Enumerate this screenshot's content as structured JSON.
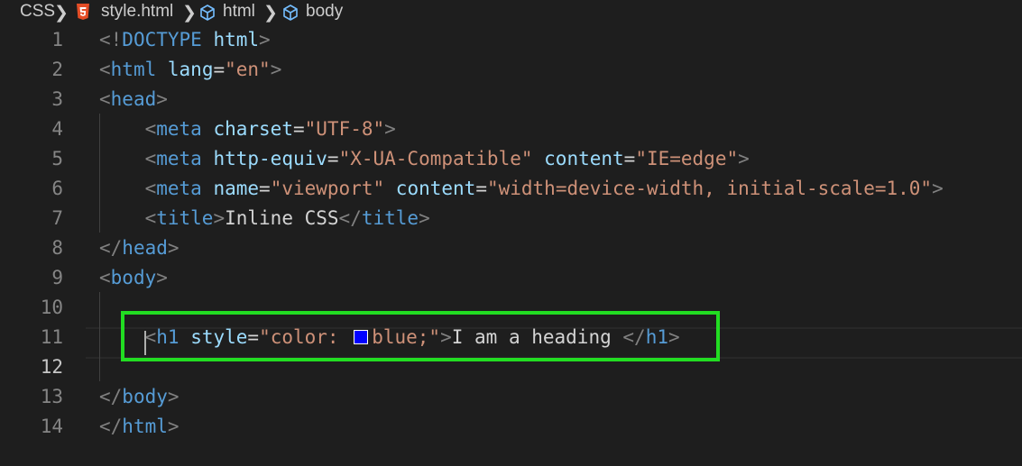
{
  "breadcrumb": {
    "items": [
      {
        "label": "CSS"
      },
      {
        "label": "style.html"
      },
      {
        "label": "html"
      },
      {
        "label": "body"
      }
    ]
  },
  "editor": {
    "current_line": 12,
    "line_numbers": [
      "1",
      "2",
      "3",
      "4",
      "5",
      "6",
      "7",
      "8",
      "9",
      "10",
      "11",
      "12",
      "13",
      "14"
    ],
    "swatch_color": "#0000ff",
    "highlight_color": "#22dd22",
    "lines": [
      [
        {
          "t": "<!",
          "c": "punct"
        },
        {
          "t": "DOCTYPE",
          "c": "tag"
        },
        {
          "t": " ",
          "c": "txt"
        },
        {
          "t": "html",
          "c": "attr"
        },
        {
          "t": ">",
          "c": "punct"
        }
      ],
      [
        {
          "t": "<",
          "c": "punct"
        },
        {
          "t": "html",
          "c": "tag"
        },
        {
          "t": " ",
          "c": "txt"
        },
        {
          "t": "lang",
          "c": "attr"
        },
        {
          "t": "=",
          "c": "txt"
        },
        {
          "t": "\"en\"",
          "c": "str"
        },
        {
          "t": ">",
          "c": "punct"
        }
      ],
      [
        {
          "t": "<",
          "c": "punct"
        },
        {
          "t": "head",
          "c": "tag"
        },
        {
          "t": ">",
          "c": "punct"
        }
      ],
      [
        {
          "t": "    ",
          "c": "txt"
        },
        {
          "t": "<",
          "c": "punct"
        },
        {
          "t": "meta",
          "c": "tag"
        },
        {
          "t": " ",
          "c": "txt"
        },
        {
          "t": "charset",
          "c": "attr"
        },
        {
          "t": "=",
          "c": "txt"
        },
        {
          "t": "\"UTF-8\"",
          "c": "str"
        },
        {
          "t": ">",
          "c": "punct"
        }
      ],
      [
        {
          "t": "    ",
          "c": "txt"
        },
        {
          "t": "<",
          "c": "punct"
        },
        {
          "t": "meta",
          "c": "tag"
        },
        {
          "t": " ",
          "c": "txt"
        },
        {
          "t": "http-equiv",
          "c": "attr"
        },
        {
          "t": "=",
          "c": "txt"
        },
        {
          "t": "\"X-UA-Compatible\"",
          "c": "str"
        },
        {
          "t": " ",
          "c": "txt"
        },
        {
          "t": "content",
          "c": "attr"
        },
        {
          "t": "=",
          "c": "txt"
        },
        {
          "t": "\"IE=edge\"",
          "c": "str"
        },
        {
          "t": ">",
          "c": "punct"
        }
      ],
      [
        {
          "t": "    ",
          "c": "txt"
        },
        {
          "t": "<",
          "c": "punct"
        },
        {
          "t": "meta",
          "c": "tag"
        },
        {
          "t": " ",
          "c": "txt"
        },
        {
          "t": "name",
          "c": "attr"
        },
        {
          "t": "=",
          "c": "txt"
        },
        {
          "t": "\"viewport\"",
          "c": "str"
        },
        {
          "t": " ",
          "c": "txt"
        },
        {
          "t": "content",
          "c": "attr"
        },
        {
          "t": "=",
          "c": "txt"
        },
        {
          "t": "\"width=device-width, initial-scale=1.0\"",
          "c": "str"
        },
        {
          "t": ">",
          "c": "punct"
        }
      ],
      [
        {
          "t": "    ",
          "c": "txt"
        },
        {
          "t": "<",
          "c": "punct"
        },
        {
          "t": "title",
          "c": "tag"
        },
        {
          "t": ">",
          "c": "punct"
        },
        {
          "t": "Inline CSS",
          "c": "txt"
        },
        {
          "t": "</",
          "c": "punct"
        },
        {
          "t": "title",
          "c": "tag"
        },
        {
          "t": ">",
          "c": "punct"
        }
      ],
      [
        {
          "t": "</",
          "c": "punct"
        },
        {
          "t": "head",
          "c": "tag"
        },
        {
          "t": ">",
          "c": "punct"
        }
      ],
      [
        {
          "t": "<",
          "c": "punct"
        },
        {
          "t": "body",
          "c": "tag"
        },
        {
          "t": ">",
          "c": "punct"
        }
      ],
      [],
      [
        {
          "t": "    ",
          "c": "txt"
        },
        {
          "t": "<",
          "c": "punct"
        },
        {
          "t": "h1",
          "c": "tag"
        },
        {
          "t": " ",
          "c": "txt"
        },
        {
          "t": "style",
          "c": "attr"
        },
        {
          "t": "=",
          "c": "txt"
        },
        {
          "t": "\"color: ",
          "c": "str"
        },
        {
          "t": "",
          "c": "swatch"
        },
        {
          "t": "blue;\"",
          "c": "str"
        },
        {
          "t": ">",
          "c": "punct"
        },
        {
          "t": "I am a heading ",
          "c": "txt"
        },
        {
          "t": "</",
          "c": "punct"
        },
        {
          "t": "h1",
          "c": "tag"
        },
        {
          "t": ">",
          "c": "punct"
        }
      ],
      [],
      [
        {
          "t": "</",
          "c": "punct"
        },
        {
          "t": "body",
          "c": "tag"
        },
        {
          "t": ">",
          "c": "punct"
        }
      ],
      [
        {
          "t": "</",
          "c": "punct"
        },
        {
          "t": "html",
          "c": "tag"
        },
        {
          "t": ">",
          "c": "punct"
        }
      ]
    ]
  }
}
